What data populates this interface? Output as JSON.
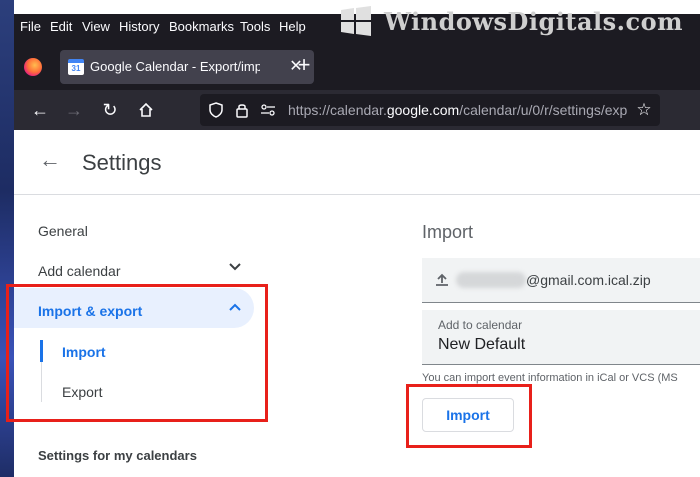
{
  "menubar": {
    "items": [
      "File",
      "Edit",
      "View",
      "History",
      "Bookmarks",
      "Tools",
      "Help"
    ]
  },
  "watermark": {
    "text": "WindowsDigitals.com"
  },
  "tab": {
    "title": "Google Calendar - Export/impo",
    "favicon": "31",
    "close": "✕"
  },
  "newtab": {
    "label": "+"
  },
  "url": {
    "prefix": "https://calendar.",
    "domain": "google.com",
    "path": "/calendar/u/0/r/settings/exp"
  },
  "settings": {
    "title": "Settings",
    "nav": {
      "general": "General",
      "add_calendar": "Add calendar",
      "import_export": "Import & export",
      "sub_import": "Import",
      "sub_export": "Export",
      "my_calendars": "Settings for my calendars"
    },
    "import": {
      "section_title": "Import",
      "file_name": "@gmail.com.ical.zip",
      "add_to_label": "Add to calendar",
      "add_to_value": "New Default",
      "helper": "You can import event information in iCal or VCS (MS",
      "button": "Import"
    }
  },
  "colors": {
    "accent": "#1a73e8",
    "highlight": "#e8201a",
    "chrome_dark": "#1c1b22"
  },
  "icons": [
    "firefox-logo-icon",
    "back-icon",
    "forward-icon",
    "reload-icon",
    "home-icon",
    "shield-icon",
    "lock-icon",
    "permissions-icon",
    "bookmark-star-icon",
    "back-arrow-icon",
    "chevron-down-icon",
    "chevron-up-icon",
    "upload-icon"
  ]
}
